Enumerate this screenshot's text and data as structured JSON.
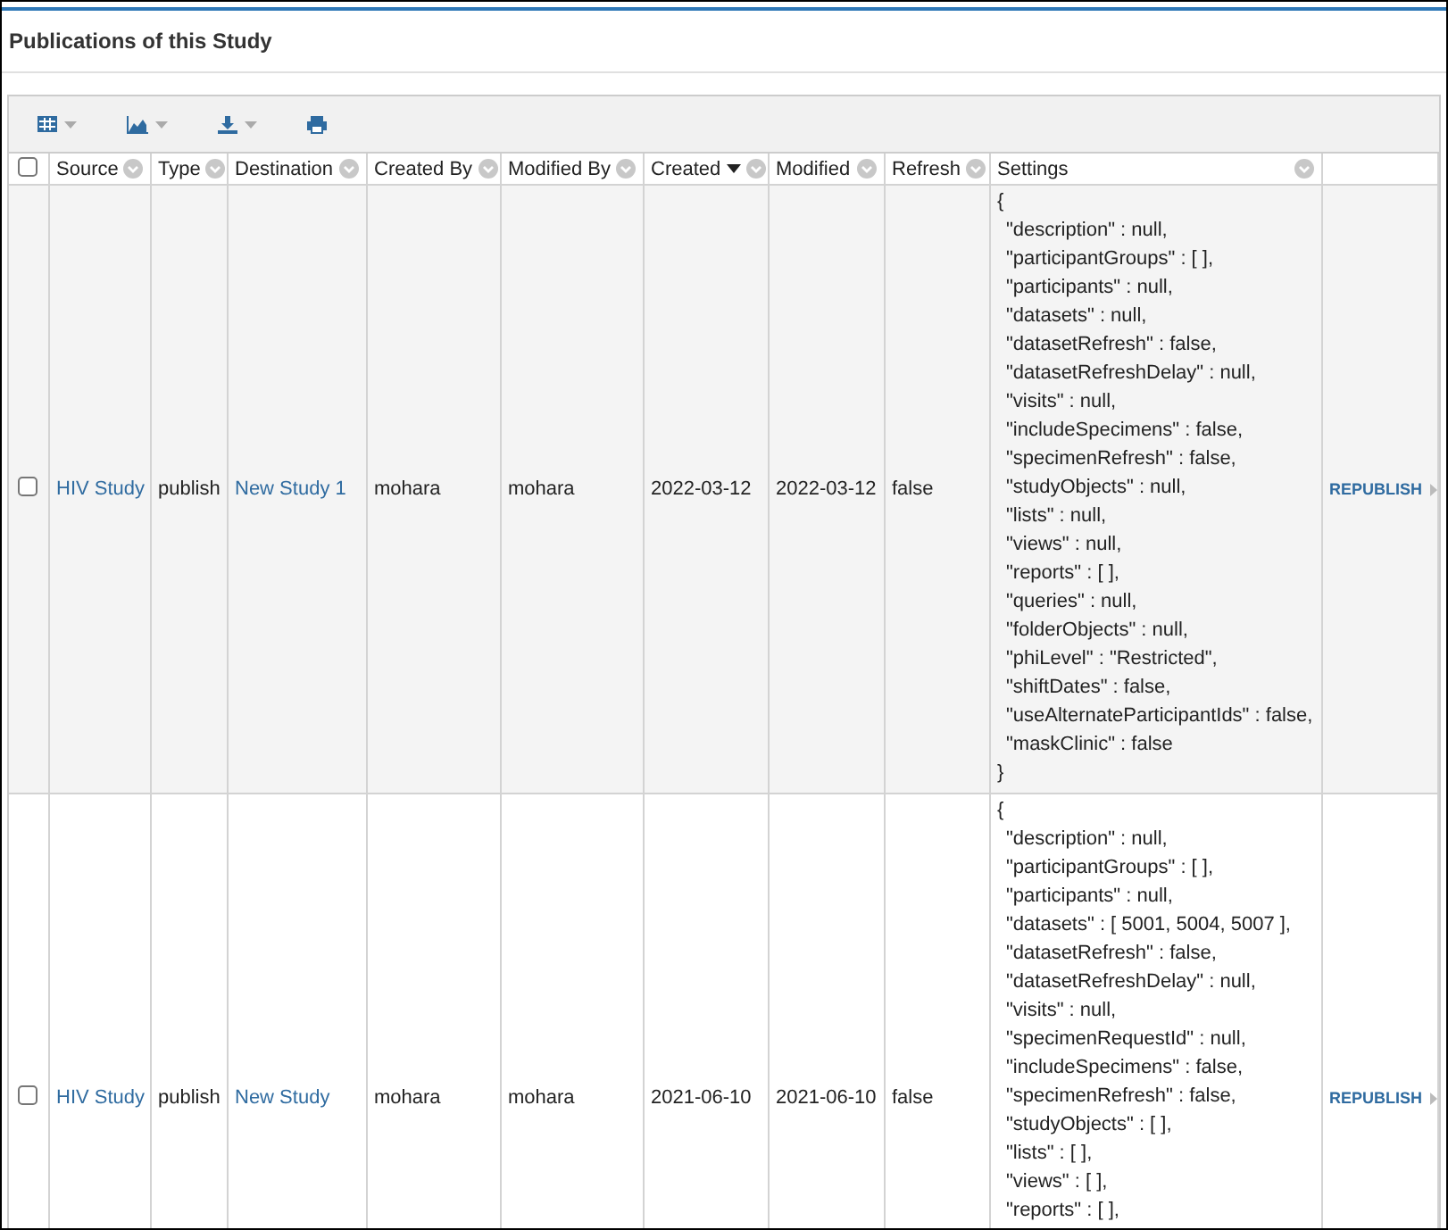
{
  "panel": {
    "title": "Publications of this Study"
  },
  "toolbar": [
    {
      "kind": "grid",
      "caret": true
    },
    {
      "kind": "chart",
      "caret": true
    },
    {
      "kind": "export",
      "caret": true
    },
    {
      "kind": "print",
      "caret": false
    }
  ],
  "header_checkbox": {
    "checked": false
  },
  "columns": [
    {
      "label": "Source",
      "sorted": false
    },
    {
      "label": "Type",
      "sorted": false
    },
    {
      "label": "Destination",
      "sorted": false
    },
    {
      "label": "Created By",
      "sorted": false
    },
    {
      "label": "Modified By",
      "sorted": false
    },
    {
      "label": "Created",
      "sorted": true
    },
    {
      "label": "Modified",
      "sorted": false
    },
    {
      "label": "Refresh",
      "sorted": false
    },
    {
      "label": "Settings",
      "sorted": false
    }
  ],
  "rows": [
    {
      "selected": false,
      "source": "HIV Study",
      "type": "publish",
      "destination": "New Study 1",
      "created_by": "mohara",
      "modified_by": "mohara",
      "created": "2022-03-12",
      "modified": "2022-03-12",
      "refresh": "false",
      "settings": {
        "open": "{",
        "lines": [
          "\"description\" : null,",
          "\"participantGroups\" : [ ],",
          "\"participants\" : null,",
          "\"datasets\" : null,",
          "\"datasetRefresh\" : false,",
          "\"datasetRefreshDelay\" : null,",
          "\"visits\" : null,",
          "\"includeSpecimens\" : false,",
          "\"specimenRefresh\" : false,",
          "\"studyObjects\" : null,",
          "\"lists\" : null,",
          "\"views\" : null,",
          "\"reports\" : [ ],",
          "\"queries\" : null,",
          "\"folderObjects\" : null,",
          "\"phiLevel\" : \"Restricted\",",
          "\"shiftDates\" : false,",
          "\"useAlternateParticipantIds\" : false,",
          "\"maskClinic\" : false"
        ],
        "close": "}"
      },
      "action": "REPUBLISH"
    },
    {
      "selected": false,
      "source": "HIV Study",
      "type": "publish",
      "destination": "New Study",
      "created_by": "mohara",
      "modified_by": "mohara",
      "created": "2021-06-10",
      "modified": "2021-06-10",
      "refresh": "false",
      "settings": {
        "open": "{",
        "lines": [
          "\"description\" : null,",
          "\"participantGroups\" : [ ],",
          "\"participants\" : null,",
          "\"datasets\" : [ 5001, 5004, 5007 ],",
          "\"datasetRefresh\" : false,",
          "\"datasetRefreshDelay\" : null,",
          "\"visits\" : null,",
          "\"specimenRequestId\" : null,",
          "\"includeSpecimens\" : false,",
          "\"specimenRefresh\" : false,",
          "\"studyObjects\" : [ ],",
          "\"lists\" : [ ],",
          "\"views\" : [ ],",
          "\"reports\" : [ ],"
        ]
      },
      "action": "REPUBLISH"
    }
  ]
}
